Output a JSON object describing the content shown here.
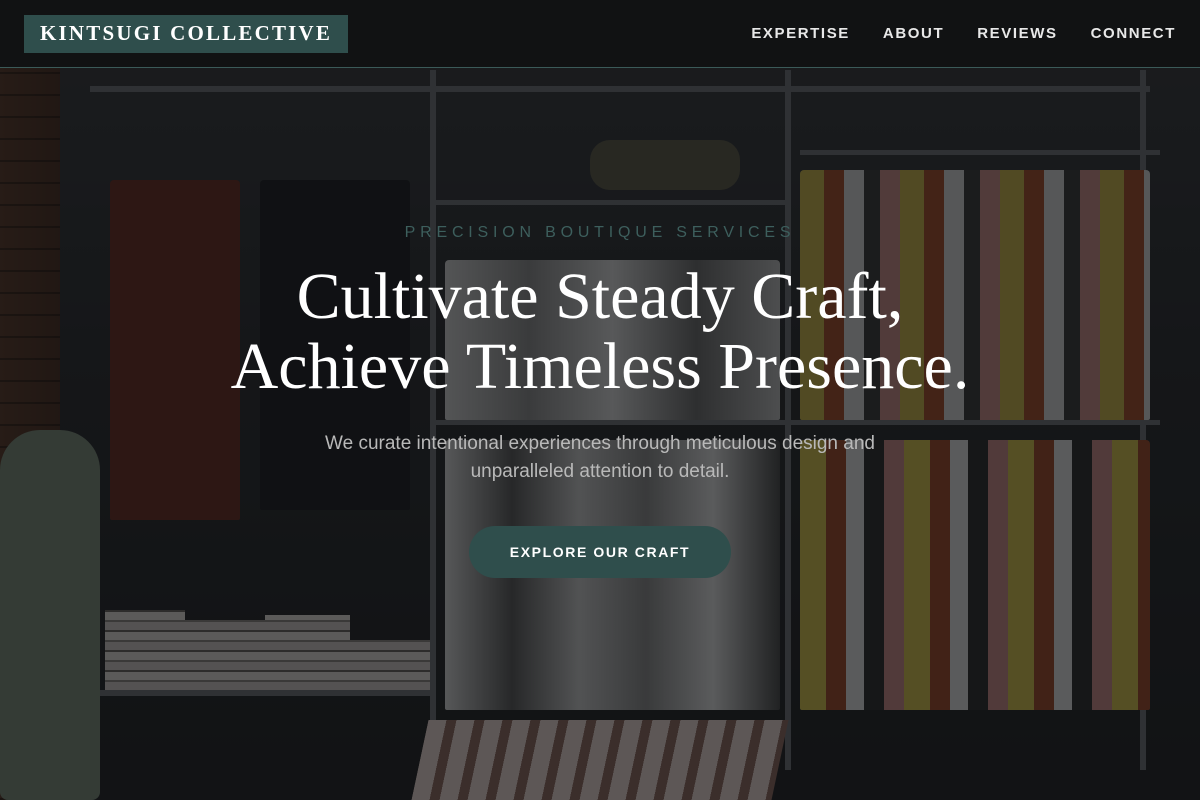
{
  "header": {
    "brand": "KINTSUGI COLLECTIVE",
    "nav": [
      "EXPERTISE",
      "ABOUT",
      "REVIEWS",
      "CONNECT"
    ]
  },
  "hero": {
    "eyebrow": "PRECISION BOUTIQUE SERVICES",
    "headline_line1": "Cultivate Steady Craft,",
    "headline_line2": "Achieve Timeless Presence.",
    "subheadline_line1": "We curate intentional experiences through meticulous design and",
    "subheadline_line2": "unparalleled attention to detail.",
    "cta_label": "EXPLORE OUR CRAFT"
  },
  "colors": {
    "accent": "#2f4e4c",
    "header_bg": "#111213",
    "eyebrow_text": "#3d5f5d"
  }
}
